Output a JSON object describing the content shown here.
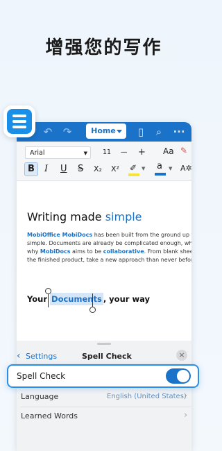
{
  "headline": "增强您的写作",
  "appbar": {
    "home_label": "Home",
    "icons": [
      "undo-icon",
      "redo-icon",
      "document-icon",
      "search-icon",
      "more-icon"
    ]
  },
  "toolbar": {
    "font_name": "Arial",
    "font_size": "11",
    "decrease_label": "—",
    "increase_label": "+",
    "font_size_icon_label": "Aa",
    "format": {
      "bold": "B",
      "italic": "I",
      "underline": "U",
      "strike": "S",
      "subscript": "X₂",
      "superscript": "X²",
      "text_color": "a"
    }
  },
  "document": {
    "title_plain": "Writing made ",
    "title_accent": "simple",
    "para_brand": "MobiOffice MobiDocs",
    "para_1": " has been built from the ground up to be simple. Documents are already be complicated enough, which is why ",
    "para_brand2": "MobiDocs",
    "para_2": " aims to be ",
    "para_brand3": "collaborative",
    "para_3": ". From blank sheets to the finished product, take a new approach than never before.",
    "your_prefix": "Your ",
    "your_selected": "Documents",
    "your_suffix": ", your way"
  },
  "sheet": {
    "back_label": "Settings",
    "title": "Spell Check",
    "close_label": "×",
    "spell_check_label": "Spell Check",
    "spell_check_on": true,
    "language_label": "Language",
    "language_value": "English (United States)",
    "learned_words_label": "Learned Words"
  },
  "colors": {
    "accent": "#1a73c9",
    "highlight_border": "#2b8fe6"
  }
}
